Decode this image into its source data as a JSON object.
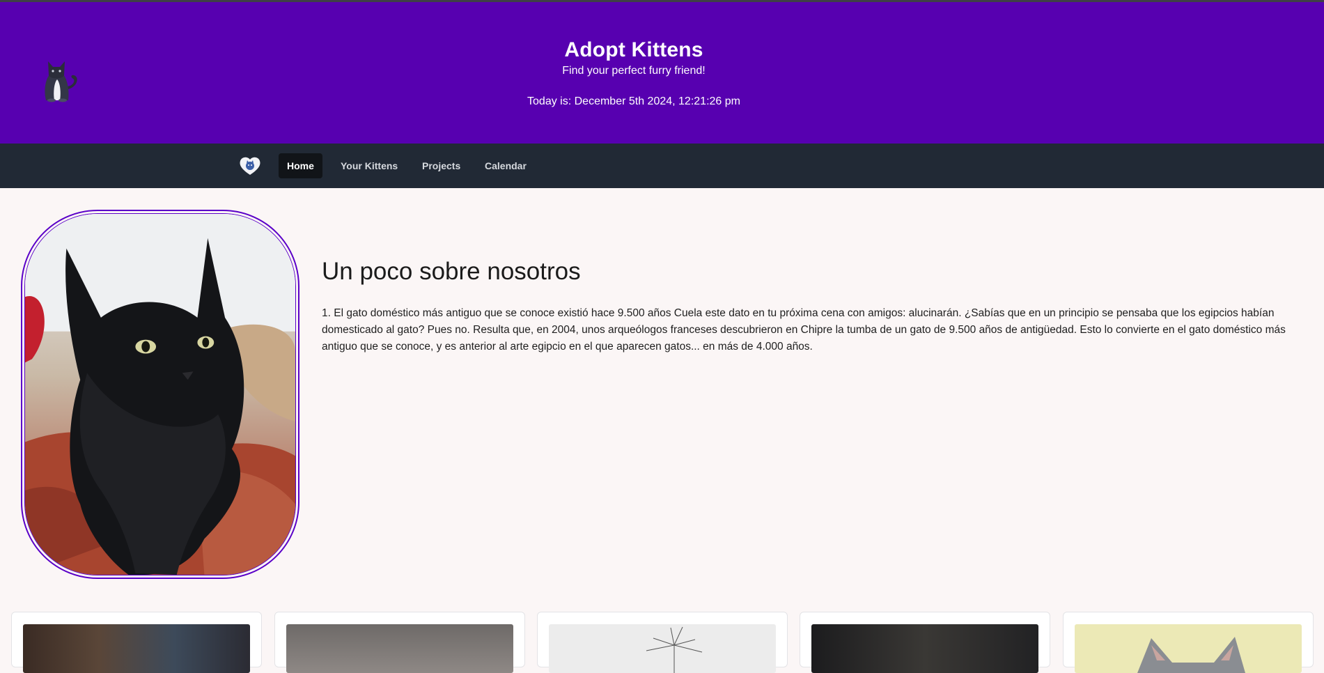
{
  "header": {
    "title": "Adopt Kittens",
    "subtitle": "Find your perfect furry friend!",
    "date_prefix": "Today is:",
    "date_value": "December 5th 2024, 12:21:26 pm"
  },
  "colors": {
    "header_bg": "#5700b0",
    "navbar_bg": "#212935",
    "page_bg": "#fbf6f6",
    "accent_border": "#5a00c8"
  },
  "nav": {
    "brand_icon": "kitten-heart-logo-icon",
    "items": [
      {
        "label": "Home",
        "active": true
      },
      {
        "label": "Your Kittens",
        "active": false
      },
      {
        "label": "Projects",
        "active": false
      },
      {
        "label": "Calendar",
        "active": false
      }
    ]
  },
  "about": {
    "title": "Un poco sobre nosotros",
    "text": "1. El gato doméstico más antiguo que se conoce existió hace 9.500 años Cuela este dato en tu próxima cena con amigos: alucinarán. ¿Sabías que en un principio se pensaba que los egipcios habían domesticado al gato? Pues no. Resulta que, en 2004, unos arqueólogos franceses descubrieron en Chipre la tumba de un gato de 9.500 años de antigüedad. Esto lo convierte en el gato doméstico más antiguo que se conoce, y es anterior al arte egipcio en el que aparecen gatos... en más de 4.000 años."
  },
  "cards": [
    {
      "image": "kitten-photo-1"
    },
    {
      "image": "kitten-photo-2"
    },
    {
      "image": "kitten-photo-3"
    },
    {
      "image": "kitten-photo-4"
    },
    {
      "image": "kitten-photo-5"
    }
  ]
}
